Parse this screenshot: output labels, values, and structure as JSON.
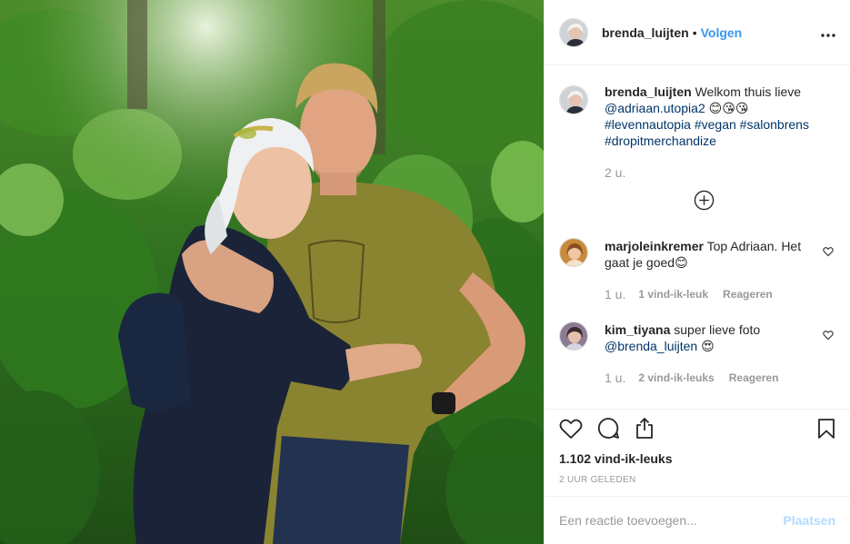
{
  "post": {
    "image_alt": "Two people hugging in a green forest"
  },
  "header": {
    "username": "brenda_luijten",
    "separator": "•",
    "follow_label": "Volgen",
    "more_icon": "more-options-icon"
  },
  "caption": {
    "username": "brenda_luijten",
    "text": "Welkom thuis lieve",
    "mention": "@adriaan.utopia2",
    "emoji": "😊😘😘",
    "hashtags_line1": "#levennautopia #vegan #salonbrens",
    "hashtags_line2": "#dropitmerchandize",
    "time": "2 u."
  },
  "load_more_icon": "plus-circle-icon",
  "comments": [
    {
      "username": "marjoleinkremer",
      "text": "Top Adriaan. Het gaat je goed😊",
      "time": "1 u.",
      "likes": "1 vind-ik-leuk",
      "reply": "Reageren"
    },
    {
      "username": "kim_tiyana",
      "text": "super lieve foto",
      "mention": "@brenda_luijten",
      "emoji": "😍",
      "time": "1 u.",
      "likes": "2 vind-ik-leuks",
      "reply": "Reageren"
    }
  ],
  "actions": {
    "icons": [
      "heart-icon",
      "comment-icon",
      "share-icon",
      "bookmark-icon"
    ],
    "likes": "1.102 vind-ik-leuks",
    "posted": "2 UUR GELEDEN"
  },
  "add_comment": {
    "placeholder": "Een reactie toevoegen...",
    "post_label": "Plaatsen"
  },
  "colors": {
    "link": "#003569",
    "follow": "#3897f0",
    "muted": "#999999",
    "post_disabled": "#b3dbff"
  }
}
